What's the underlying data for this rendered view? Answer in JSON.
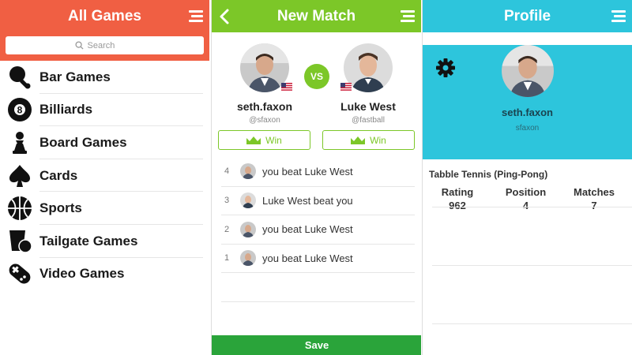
{
  "categories_panel": {
    "title": "All Games",
    "search_placeholder": "Search",
    "items": [
      {
        "label": "Bar Games",
        "icon": "ping-pong-paddle-icon"
      },
      {
        "label": "Billiards",
        "icon": "eight-ball-icon"
      },
      {
        "label": "Board Games",
        "icon": "chess-pawn-icon"
      },
      {
        "label": "Cards",
        "icon": "spade-icon"
      },
      {
        "label": "Sports",
        "icon": "basketball-icon"
      },
      {
        "label": "Tailgate Games",
        "icon": "beer-pong-icon"
      },
      {
        "label": "Video Games",
        "icon": "gamepad-icon"
      }
    ],
    "accent_color": "#f05f43"
  },
  "match_panel": {
    "title": "New Match",
    "vs_label": "VS",
    "player1": {
      "name": "seth.faxon",
      "handle": "@sfaxon",
      "win_label": "Win"
    },
    "player2": {
      "name": "Luke West",
      "handle": "@fastball",
      "win_label": "Win"
    },
    "results": [
      {
        "number": "4",
        "text": "you beat Luke West",
        "avatar": "seth"
      },
      {
        "number": "3",
        "text": "Luke West beat you",
        "avatar": "luke"
      },
      {
        "number": "2",
        "text": "you beat Luke West",
        "avatar": "seth"
      },
      {
        "number": "1",
        "text": "you beat Luke West",
        "avatar": "seth"
      }
    ],
    "save_label": "Save",
    "accent_color": "#7cc728",
    "save_color": "#2aa43a"
  },
  "profile_panel": {
    "title": "Profile",
    "name": "seth.faxon",
    "handle": "sfaxon",
    "game": "Tabble Tennis (Ping-Pong)",
    "stats": [
      {
        "label": "Rating",
        "value": "962"
      },
      {
        "label": "Position",
        "value": "4"
      },
      {
        "label": "Matches",
        "value": "7"
      }
    ],
    "accent_color": "#2dc5dc"
  }
}
